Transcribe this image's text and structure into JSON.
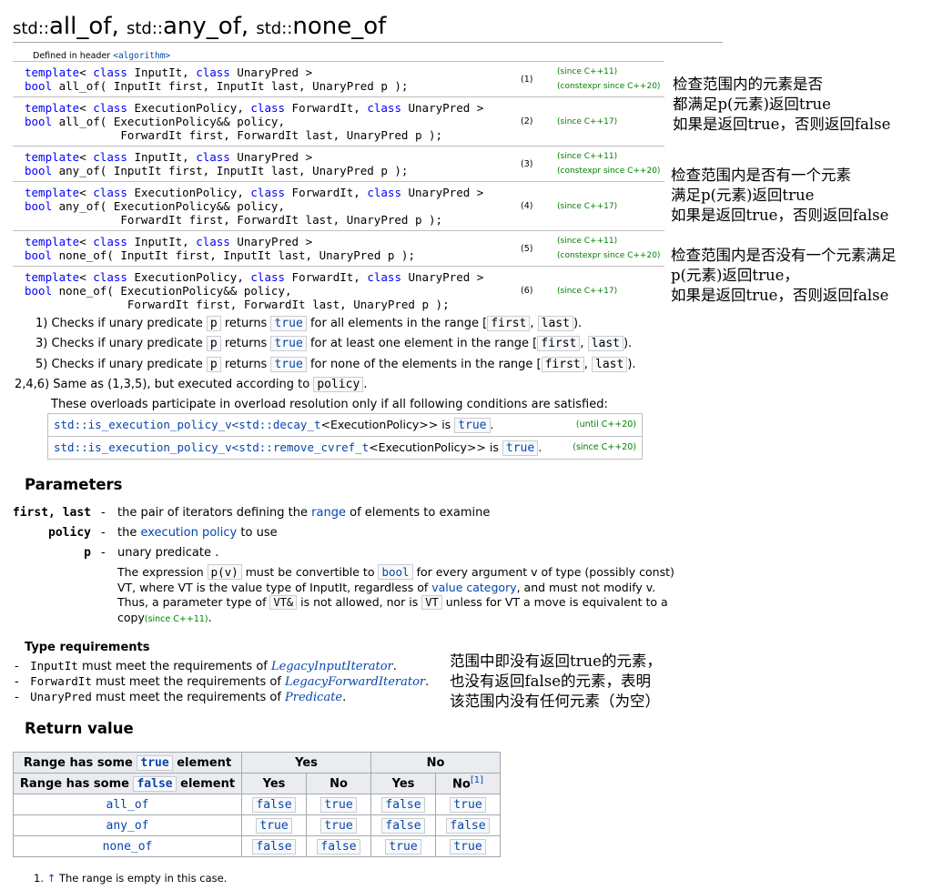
{
  "title": {
    "ns1": "std::",
    "f1": "all_of",
    "sep1": ", ",
    "ns2": "std::",
    "f2": "any_of",
    "sep2": ", ",
    "ns3": "std::",
    "f3": "none_of"
  },
  "defined_in": {
    "prefix": "Defined in header ",
    "header": "<algorithm>"
  },
  "declarations": [
    {
      "lines": [
        [
          [
            "kw",
            "template"
          ],
          [
            "t",
            "< "
          ],
          [
            "kw",
            "class"
          ],
          [
            "t",
            " InputIt, "
          ],
          [
            "kw",
            "class"
          ],
          [
            "t",
            " UnaryPred >"
          ]
        ],
        [
          [
            "kw",
            "bool"
          ],
          [
            "t",
            " all_of( InputIt first, InputIt last, UnaryPred p );"
          ]
        ]
      ],
      "num": "(1)",
      "since": [
        "(since C++11)",
        "(constexpr since C++20)"
      ]
    },
    {
      "lines": [
        [
          [
            "kw",
            "template"
          ],
          [
            "t",
            "< "
          ],
          [
            "kw",
            "class"
          ],
          [
            "t",
            " ExecutionPolicy, "
          ],
          [
            "kw",
            "class"
          ],
          [
            "t",
            " ForwardIt, "
          ],
          [
            "kw",
            "class"
          ],
          [
            "t",
            " UnaryPred >"
          ]
        ],
        [
          [
            "kw",
            "bool"
          ],
          [
            "t",
            " all_of( ExecutionPolicy&& policy,"
          ]
        ],
        [
          [
            "t",
            "              ForwardIt first, ForwardIt last, UnaryPred p );"
          ]
        ]
      ],
      "num": "(2)",
      "since": [
        "(since C++17)"
      ]
    },
    {
      "lines": [
        [
          [
            "kw",
            "template"
          ],
          [
            "t",
            "< "
          ],
          [
            "kw",
            "class"
          ],
          [
            "t",
            " InputIt, "
          ],
          [
            "kw",
            "class"
          ],
          [
            "t",
            " UnaryPred >"
          ]
        ],
        [
          [
            "kw",
            "bool"
          ],
          [
            "t",
            " any_of( InputIt first, InputIt last, UnaryPred p );"
          ]
        ]
      ],
      "num": "(3)",
      "since": [
        "(since C++11)",
        "(constexpr since C++20)"
      ]
    },
    {
      "lines": [
        [
          [
            "kw",
            "template"
          ],
          [
            "t",
            "< "
          ],
          [
            "kw",
            "class"
          ],
          [
            "t",
            " ExecutionPolicy, "
          ],
          [
            "kw",
            "class"
          ],
          [
            "t",
            " ForwardIt, "
          ],
          [
            "kw",
            "class"
          ],
          [
            "t",
            " UnaryPred >"
          ]
        ],
        [
          [
            "kw",
            "bool"
          ],
          [
            "t",
            " any_of( ExecutionPolicy&& policy,"
          ]
        ],
        [
          [
            "t",
            "              ForwardIt first, ForwardIt last, UnaryPred p );"
          ]
        ]
      ],
      "num": "(4)",
      "since": [
        "(since C++17)"
      ]
    },
    {
      "lines": [
        [
          [
            "kw",
            "template"
          ],
          [
            "t",
            "< "
          ],
          [
            "kw",
            "class"
          ],
          [
            "t",
            " InputIt, "
          ],
          [
            "kw",
            "class"
          ],
          [
            "t",
            " UnaryPred >"
          ]
        ],
        [
          [
            "kw",
            "bool"
          ],
          [
            "t",
            " none_of( InputIt first, InputIt last, UnaryPred p );"
          ]
        ]
      ],
      "num": "(5)",
      "since": [
        "(since C++11)",
        "(constexpr since C++20)"
      ]
    },
    {
      "lines": [
        [
          [
            "kw",
            "template"
          ],
          [
            "t",
            "< "
          ],
          [
            "kw",
            "class"
          ],
          [
            "t",
            " ExecutionPolicy, "
          ],
          [
            "kw",
            "class"
          ],
          [
            "t",
            " ForwardIt, "
          ],
          [
            "kw",
            "class"
          ],
          [
            "t",
            " UnaryPred >"
          ]
        ],
        [
          [
            "kw",
            "bool"
          ],
          [
            "t",
            " none_of( ExecutionPolicy&& policy,"
          ]
        ],
        [
          [
            "t",
            "               ForwardIt first, ForwardIt last, UnaryPred p );"
          ]
        ]
      ],
      "num": "(6)",
      "since": [
        "(since C++17)"
      ]
    }
  ],
  "notes": {
    "n1": [
      "检查范围内的元素是否",
      "都满足p(元素)返回true",
      "如果是返回true，否则返回false"
    ],
    "n2": [
      "检查范围内是否有一个元素",
      "满足p(元素)返回true",
      "如果是返回true，否则返回false"
    ],
    "n3": [
      "检查范围内是否没有一个元素满足",
      "p(元素)返回true，",
      "如果是返回true，否则返回false"
    ],
    "n4": [
      "范围中即没有返回true的元素，",
      "也没有返回false的元素，表明",
      "该范围内没有任何元素（为空）"
    ]
  },
  "desc": {
    "d1": {
      "num": "1)",
      "a": "Checks if unary predicate",
      "p": "p",
      "b": "returns",
      "t": "true",
      "c": "for all elements in the range [",
      "first": "first",
      "comma": ",",
      "last": "last",
      "end": ")."
    },
    "d3": {
      "num": "3)",
      "a": "Checks if unary predicate",
      "p": "p",
      "b": "returns",
      "t": "true",
      "c": "for at least one element in the range [",
      "first": "first",
      "comma": ",",
      "last": "last",
      "end": ")."
    },
    "d5": {
      "num": "5)",
      "a": "Checks if unary predicate",
      "p": "p",
      "b": "returns",
      "t": "true",
      "c": "for none of the elements in the range [",
      "first": "first",
      "comma": ",",
      "last": "last",
      "end": ")."
    },
    "d246": {
      "num": "2,4,6)",
      "a": "Same as (1,3,5), but executed according to",
      "policy": "policy",
      "end": "."
    },
    "overload": "These overloads participate in overload resolution only if all following conditions are satisfied:",
    "cond1": {
      "code": "std::is_execution_policy_v<std::decay_t",
      "mid": "<ExecutionPolicy>>",
      "is": "is",
      "t": "true",
      "dot": ".",
      "since": "(until C++20)"
    },
    "cond2": {
      "code": "std::is_execution_policy_v<std::remove_cvref_t",
      "mid": "<ExecutionPolicy>>",
      "is": "is",
      "t": "true",
      "dot": ".",
      "since": "(since C++20)"
    }
  },
  "params": {
    "heading": "Parameters",
    "first_last": {
      "name": "first, last",
      "dash": "-",
      "a": "the pair of iterators defining the",
      "link": "range",
      "b": "of elements to examine"
    },
    "policy": {
      "name": "policy",
      "dash": "-",
      "a": "the",
      "link": "execution policy",
      "b": "to use"
    },
    "p": {
      "name": "p",
      "dash": "-",
      "a": "unary predicate ."
    },
    "expr": {
      "l1a": "The expression",
      "l1code": "p(v)",
      "l1b": "must be convertible to",
      "l1bool": "bool",
      "l1c": "for every argument v of type (possibly const)",
      "l2a": "VT, where VT is the value type of InputIt, regardless of",
      "l2link": "value category",
      "l2b": ", and must not modify v.",
      "l3a": "Thus, a parameter type of",
      "l3code": "VT&",
      "l3b": "is not allowed, nor is",
      "l3vt": "VT",
      "l3c": "unless for VT a move is equivalent to a",
      "l4a": "copy",
      "l4since": "(since C++11)",
      "l4b": "."
    }
  },
  "typereq": {
    "heading": "Type requirements",
    "r1": {
      "dash": "-",
      "type": "InputIt",
      "a": "must meet the requirements of",
      "link": "LegacyInputIterator",
      "end": "."
    },
    "r2": {
      "dash": "-",
      "type": "ForwardIt",
      "a": "must meet the requirements of",
      "link": "LegacyForwardIterator",
      "end": "."
    },
    "r3": {
      "dash": "-",
      "type": "UnaryPred",
      "a": "must meet the requirements of",
      "link": "Predicate",
      "end": "."
    }
  },
  "retval": {
    "heading": "Return value",
    "h1": {
      "a": "Range has some",
      "t": "true",
      "b": "element",
      "yes": "Yes",
      "no": "No"
    },
    "h2": {
      "a": "Range has some",
      "t": "false",
      "b": "element",
      "c1": "Yes",
      "c2": "No",
      "c3": "Yes",
      "c4": "No",
      "sup": "[1]"
    },
    "rows": [
      {
        "name": "all_of",
        "v": [
          "false",
          "true",
          "false",
          "true"
        ]
      },
      {
        "name": "any_of",
        "v": [
          "true",
          "true",
          "false",
          "false"
        ]
      },
      {
        "name": "none_of",
        "v": [
          "false",
          "false",
          "true",
          "true"
        ]
      }
    ],
    "footnote": {
      "num": "1.",
      "arrow": "↑",
      "text": "The range is empty in this case."
    }
  }
}
